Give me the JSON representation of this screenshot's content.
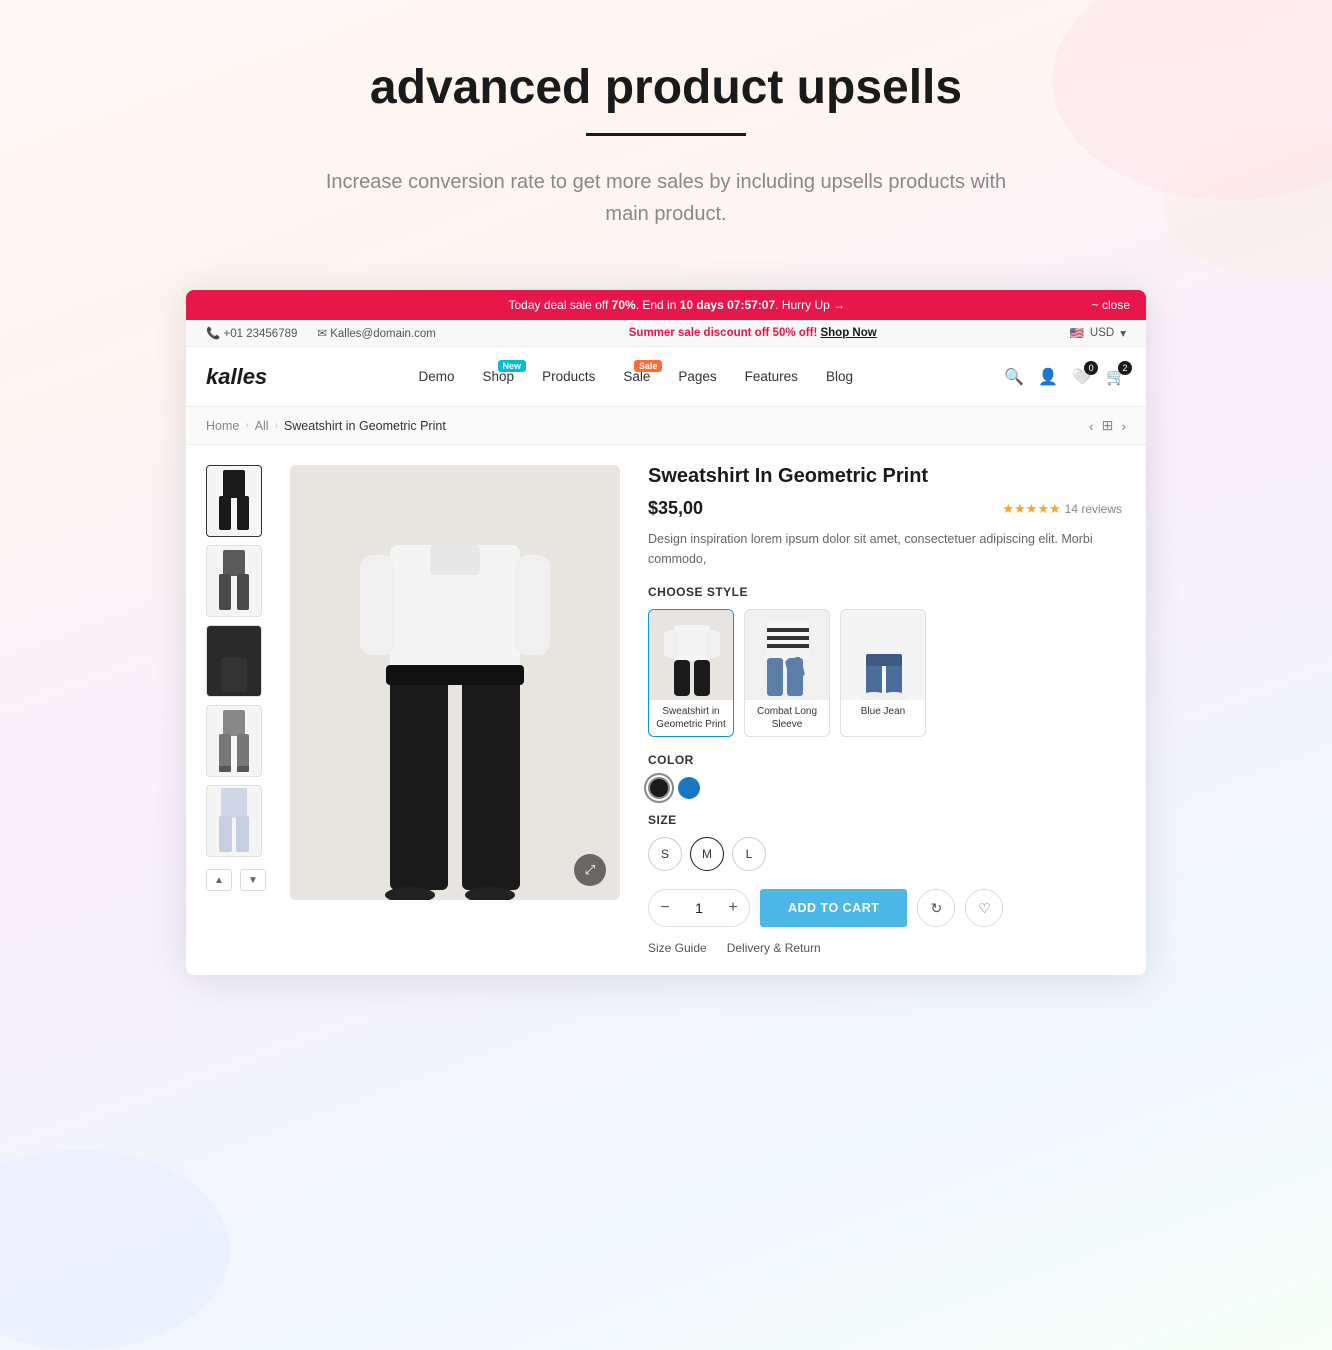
{
  "page": {
    "title": "advanced product upsells",
    "subtitle": "Increase conversion rate to get more sales by including upsells products with main product.",
    "divider": true
  },
  "announcement": {
    "text_before": "Today deal sale off ",
    "discount": "70%",
    "text_middle": ". End in ",
    "days": "10 days",
    "timer": "07:57:07",
    "text_after": ". Hurry Up →",
    "close_label": "~ close"
  },
  "topbar": {
    "phone": "+01 23456789",
    "email": "Kalles@domain.com",
    "promo": "Summer sale discount off ",
    "promo_pct": "50% off!",
    "shop_now": "Shop Now",
    "currency": "USD"
  },
  "nav": {
    "logo": "kalles",
    "links": [
      {
        "label": "Demo",
        "badge": null
      },
      {
        "label": "Shop",
        "badge": "New"
      },
      {
        "label": "Products",
        "badge": null
      },
      {
        "label": "Sale",
        "badge": "Sale"
      },
      {
        "label": "Pages",
        "badge": null
      },
      {
        "label": "Features",
        "badge": null
      },
      {
        "label": "Blog",
        "badge": null
      }
    ],
    "wishlist_count": "0",
    "cart_count": "2"
  },
  "breadcrumb": {
    "home": "Home",
    "all": "All",
    "current": "Sweatshirt in Geometric Print"
  },
  "product": {
    "name": "Sweatshirt In Geometric Print",
    "price": "$35,00",
    "reviews_count": "14 reviews",
    "description": "Design inspiration lorem ipsum dolor sit amet, consectetuer adipiscing elit. Morbi commodo,",
    "choose_style_label": "CHOOSE STYLE",
    "color_label": "COLOR",
    "size_label": "SIZE",
    "styles": [
      {
        "label": "Sweatshirt in Geometric Print"
      },
      {
        "label": "Combat Long Sleeve"
      },
      {
        "label": "Blue Jean"
      }
    ],
    "colors": [
      {
        "name": "Black",
        "hex": "#1a1a1a"
      },
      {
        "name": "Blue",
        "hex": "#1a78c2"
      }
    ],
    "sizes": [
      "S",
      "M",
      "L"
    ],
    "quantity": 1,
    "add_to_cart_label": "ADD TO CART",
    "size_guide_label": "Size Guide",
    "delivery_return_label": "Delivery & Return"
  }
}
